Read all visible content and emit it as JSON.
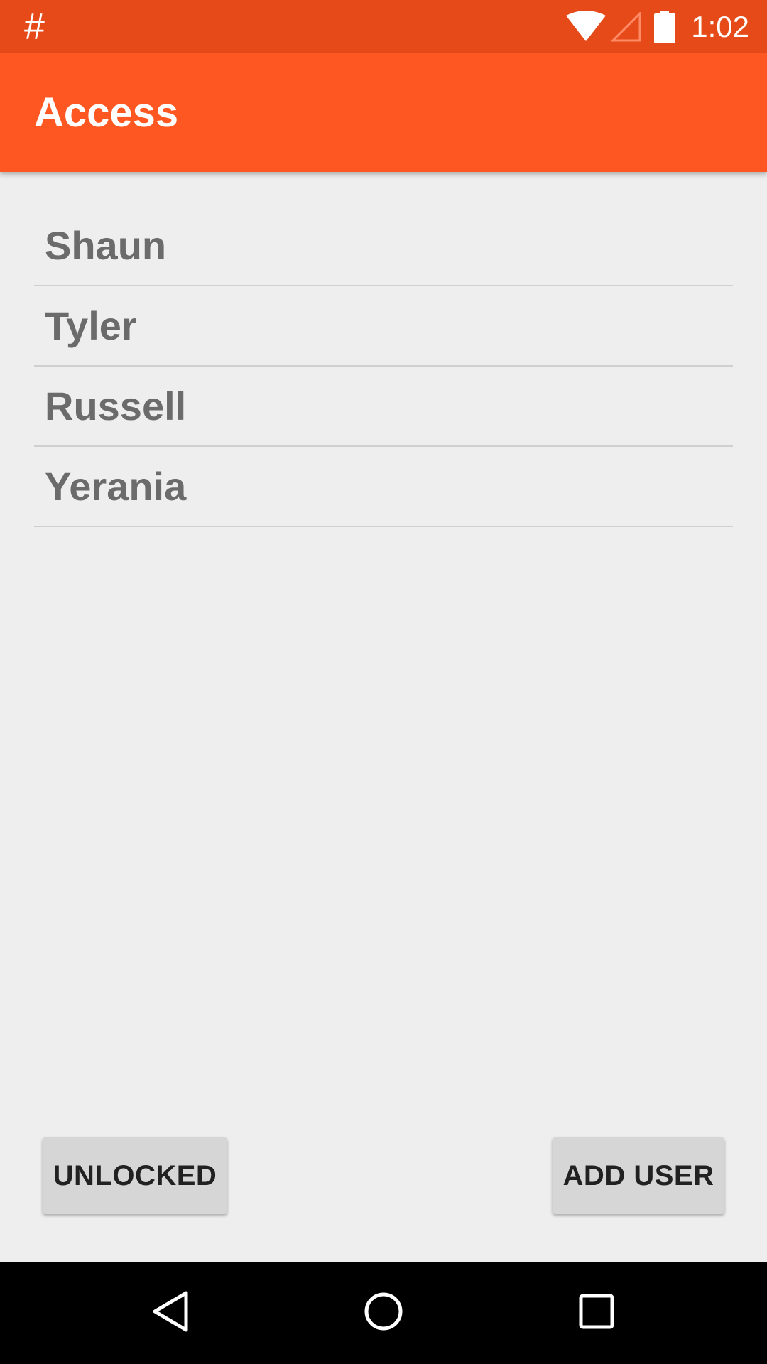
{
  "status_bar": {
    "notification_symbol": "#",
    "time": "1:02",
    "icons": [
      "wifi-icon",
      "cell-signal-icon",
      "battery-icon"
    ]
  },
  "app_bar": {
    "title": "Access"
  },
  "users": [
    {
      "name": "Shaun"
    },
    {
      "name": "Tyler"
    },
    {
      "name": "Russell"
    },
    {
      "name": "Yerania"
    }
  ],
  "buttons": {
    "unlocked_label": "UNLOCKED",
    "add_user_label": "ADD USER"
  },
  "nav_bar": {
    "icons": [
      "back-icon",
      "home-icon",
      "recents-icon"
    ]
  },
  "colors": {
    "status_bar": "#e64a19",
    "app_bar": "#ff5722",
    "background": "#eeeeee",
    "button": "#d6d6d6",
    "list_text": "#6b6b6b"
  }
}
